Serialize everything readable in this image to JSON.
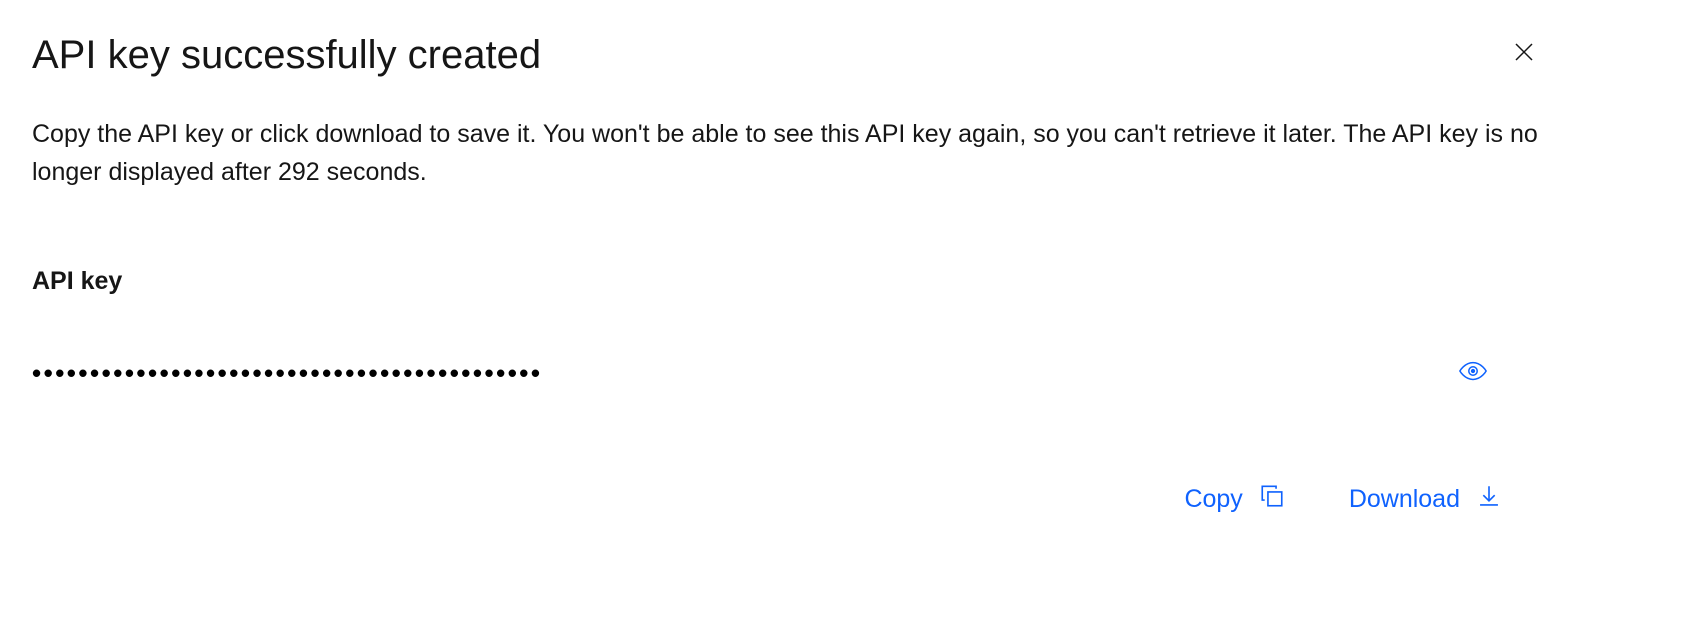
{
  "modal": {
    "title": "API key successfully created",
    "description": "Copy the API key or click download to save it. You won't be able to see this API key again, so you can't retrieve it later. The API key is no longer displayed after 292 seconds.",
    "field_label": "API key",
    "key_masked": "••••••••••••••••••••••••••••••••••••••••••••",
    "actions": {
      "copy_label": "Copy",
      "download_label": "Download"
    }
  },
  "icons": {
    "close": "close-icon",
    "eye": "eye-icon",
    "copy": "copy-icon",
    "download": "download-icon"
  },
  "colors": {
    "link": "#0f62fe",
    "text": "#161616"
  }
}
